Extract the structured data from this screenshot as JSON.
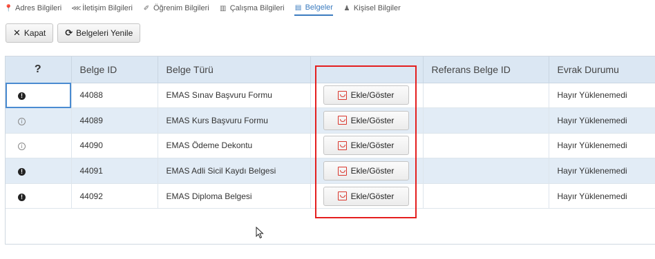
{
  "tabs": [
    {
      "icon": "map-pin-icon",
      "glyph": "📍",
      "label": "Adres Bilgileri"
    },
    {
      "icon": "share-icon",
      "glyph": "⋘",
      "label": "İletişim Bilgileri"
    },
    {
      "icon": "graduation-icon",
      "glyph": "✐",
      "label": "Öğrenim Bilgileri"
    },
    {
      "icon": "building-icon",
      "glyph": "▥",
      "label": "Çalışma Bilgileri"
    },
    {
      "icon": "document-icon",
      "glyph": "▤",
      "label": "Belgeler"
    },
    {
      "icon": "user-icon",
      "glyph": "♟",
      "label": "Kişisel Bilgiler"
    }
  ],
  "active_tab": "Belgeler",
  "toolbar": {
    "close_label": "Kapat",
    "close_icon": "x-icon",
    "refresh_label": "Belgeleri Yenile",
    "refresh_icon": "refresh-icon"
  },
  "table": {
    "headers": [
      "?",
      "Belge ID",
      "Belge Türü",
      "",
      "Referans Belge ID",
      "Evrak Durumu"
    ],
    "rows": [
      {
        "status": "required",
        "id": "44088",
        "type": "EMAS Sınav Başvuru Formu",
        "action": "Ekle/Göster",
        "ref": "",
        "evrak": "Hayır Yüklenemedi"
      },
      {
        "status": "info",
        "id": "44089",
        "type": "EMAS Kurs Başvuru Formu",
        "action": "Ekle/Göster",
        "ref": "",
        "evrak": "Hayır Yüklenemedi"
      },
      {
        "status": "info",
        "id": "44090",
        "type": "EMAS Ödeme Dekontu",
        "action": "Ekle/Göster",
        "ref": "",
        "evrak": "Hayır Yüklenemedi"
      },
      {
        "status": "required",
        "id": "44091",
        "type": "EMAS Adli Sicil Kaydı Belgesi",
        "action": "Ekle/Göster",
        "ref": "",
        "evrak": "Hayır Yüklenemedi"
      },
      {
        "status": "required",
        "id": "44092",
        "type": "EMAS Diploma Belgesi",
        "action": "Ekle/Göster",
        "ref": "",
        "evrak": "Hayır Yüklenemedi"
      }
    ]
  },
  "colors": {
    "accent": "#3a7bbf",
    "header_bg": "#dbe7f3",
    "alt_row": "#e2ecf6",
    "highlight": "#e41e1e",
    "pdf_red": "#d9352b"
  }
}
